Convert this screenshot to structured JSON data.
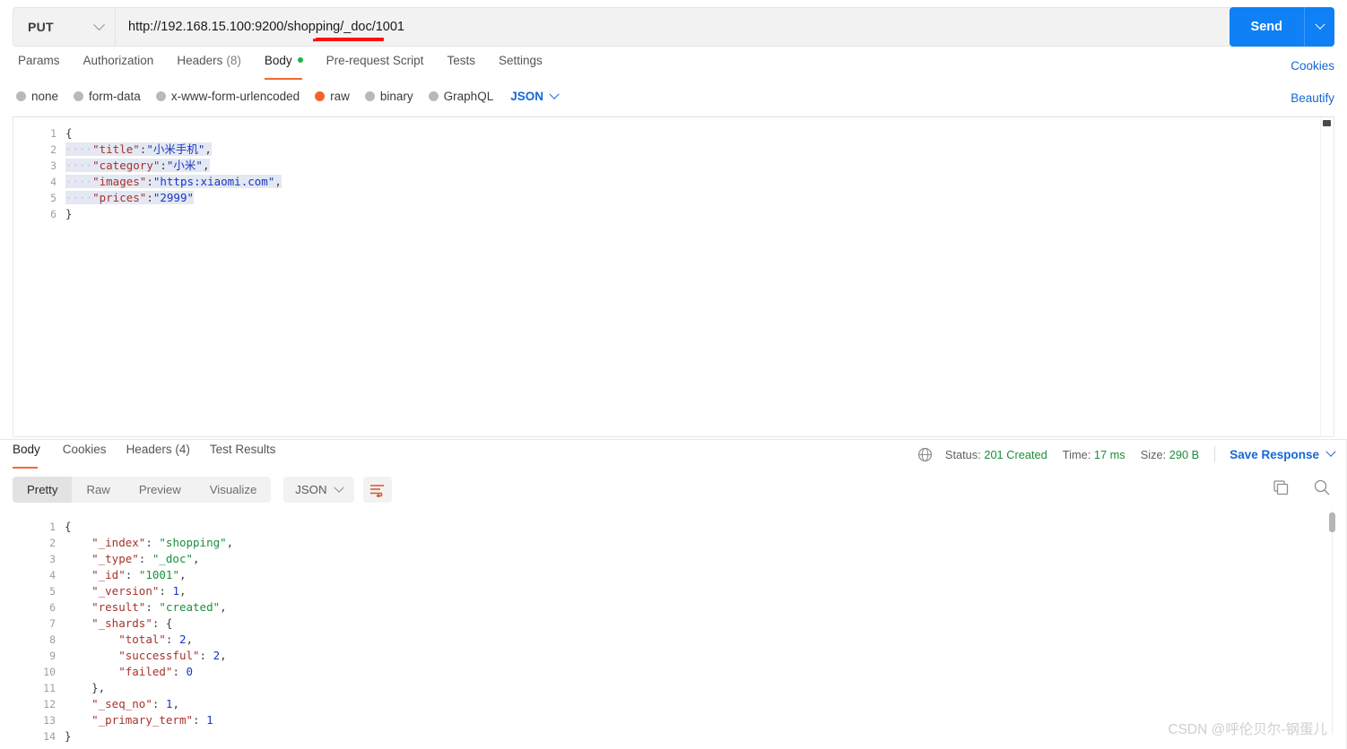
{
  "request": {
    "method": "PUT",
    "url": "http://192.168.15.100:9200/shopping/_doc/1001",
    "url_placeholder": "Enter request URL",
    "send_label": "Send",
    "cookies_label": "Cookies",
    "beautify_label": "Beautify",
    "tabs": [
      {
        "label": "Params",
        "active": false
      },
      {
        "label": "Authorization",
        "active": false
      },
      {
        "label": "Headers",
        "count": "(8)",
        "active": false
      },
      {
        "label": "Body",
        "active": true,
        "dot": true
      },
      {
        "label": "Pre-request Script",
        "active": false
      },
      {
        "label": "Tests",
        "active": false
      },
      {
        "label": "Settings",
        "active": false
      }
    ],
    "body_types": [
      {
        "label": "none",
        "selected": false
      },
      {
        "label": "form-data",
        "selected": false
      },
      {
        "label": "x-www-form-urlencoded",
        "selected": false
      },
      {
        "label": "raw",
        "selected": true
      },
      {
        "label": "binary",
        "selected": false
      },
      {
        "label": "GraphQL",
        "selected": false
      }
    ],
    "body_format": "JSON",
    "body_lines": [
      "1",
      "2",
      "3",
      "4",
      "5",
      "6"
    ],
    "body_code": [
      {
        "indent": "",
        "text": "{",
        "selected": false
      },
      {
        "indent": "····",
        "key": "\"title\"",
        "colon": ":",
        "value": "\"小米手机\"",
        "tail": ",",
        "selected": true
      },
      {
        "indent": "····",
        "key": "\"category\"",
        "colon": ":",
        "value": "\"小米\"",
        "tail": ",",
        "selected": true
      },
      {
        "indent": "····",
        "key": "\"images\"",
        "colon": ":",
        "value": "\"https:xiaomi.com\"",
        "tail": ",",
        "selected": true
      },
      {
        "indent": "····",
        "key": "\"prices\"",
        "colon": ":",
        "value": "\"2999\"",
        "tail": "",
        "selected": true
      },
      {
        "indent": "",
        "text": "}",
        "selected": false
      }
    ]
  },
  "response": {
    "tabs": [
      {
        "label": "Body",
        "active": true
      },
      {
        "label": "Cookies",
        "active": false
      },
      {
        "label": "Headers (4)",
        "active": false
      },
      {
        "label": "Test Results",
        "active": false
      }
    ],
    "views": [
      {
        "label": "Pretty",
        "active": true
      },
      {
        "label": "Raw",
        "active": false
      },
      {
        "label": "Preview",
        "active": false
      },
      {
        "label": "Visualize",
        "active": false
      }
    ],
    "format": "JSON",
    "status_label": "Status:",
    "status_value": "201 Created",
    "time_label": "Time:",
    "time_value": "17 ms",
    "size_label": "Size:",
    "size_value": "290 B",
    "save_label": "Save Response",
    "icons": {
      "globe": "globe-icon",
      "wrap": "word-wrap-icon",
      "copy": "copy-icon",
      "search": "search-icon"
    },
    "lines": [
      "1",
      "2",
      "3",
      "4",
      "5",
      "6",
      "7",
      "8",
      "9",
      "10",
      "11",
      "12",
      "13",
      "14"
    ],
    "code": [
      {
        "indent": "",
        "text": "{"
      },
      {
        "indent": "    ",
        "key": "\"_index\"",
        "colon": ": ",
        "value": "\"shopping\"",
        "type": "str",
        "tail": ","
      },
      {
        "indent": "    ",
        "key": "\"_type\"",
        "colon": ": ",
        "value": "\"_doc\"",
        "type": "str",
        "tail": ","
      },
      {
        "indent": "    ",
        "key": "\"_id\"",
        "colon": ": ",
        "value": "\"1001\"",
        "type": "str",
        "tail": ","
      },
      {
        "indent": "    ",
        "key": "\"_version\"",
        "colon": ": ",
        "value": "1",
        "type": "num",
        "tail": ","
      },
      {
        "indent": "    ",
        "key": "\"result\"",
        "colon": ": ",
        "value": "\"created\"",
        "type": "str",
        "tail": ","
      },
      {
        "indent": "    ",
        "key": "\"_shards\"",
        "colon": ": ",
        "value": "{",
        "type": "brace",
        "tail": ""
      },
      {
        "indent": "        ",
        "key": "\"total\"",
        "colon": ": ",
        "value": "2",
        "type": "num",
        "tail": ","
      },
      {
        "indent": "        ",
        "key": "\"successful\"",
        "colon": ": ",
        "value": "2",
        "type": "num",
        "tail": ","
      },
      {
        "indent": "        ",
        "key": "\"failed\"",
        "colon": ": ",
        "value": "0",
        "type": "num",
        "tail": ""
      },
      {
        "indent": "    ",
        "text": "},"
      },
      {
        "indent": "    ",
        "key": "\"_seq_no\"",
        "colon": ": ",
        "value": "1",
        "type": "num",
        "tail": ","
      },
      {
        "indent": "    ",
        "key": "\"_primary_term\"",
        "colon": ": ",
        "value": "1",
        "type": "num",
        "tail": ""
      },
      {
        "indent": "",
        "text": "}"
      }
    ]
  },
  "watermark": "CSDN @呼伦贝尔-钢蛋儿",
  "colors": {
    "accent_blue": "#0f80f5",
    "link_blue": "#1667d6",
    "tab_orange": "#f06a33",
    "radio_orange": "#f4632b",
    "status_green": "#1a8f3c",
    "annotation_red": "#fa1405"
  }
}
